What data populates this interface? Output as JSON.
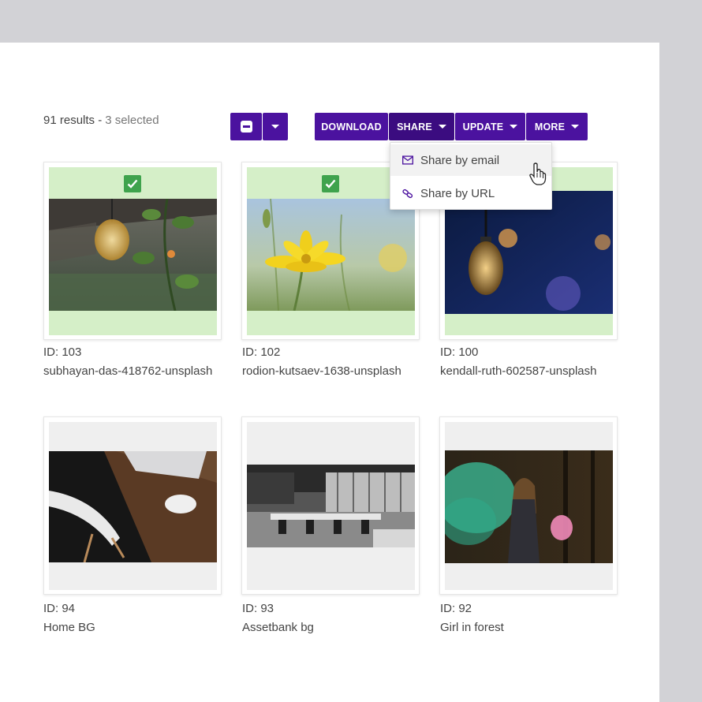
{
  "results": {
    "count_text": "91 results -",
    "selected_text": "3 selected"
  },
  "toolbar": {
    "select_icon": "minus-checkbox-icon",
    "download_label": "DOWNLOAD",
    "share_label": "SHARE",
    "update_label": "UPDATE",
    "more_label": "MORE",
    "accent": "#4b129f"
  },
  "share_menu": {
    "items": [
      {
        "label": "Share by email",
        "icon": "envelope-icon"
      },
      {
        "label": "Share by URL",
        "icon": "link-icon"
      }
    ]
  },
  "assets": [
    {
      "id_text": "ID: 103",
      "name": "subhayan-das-418762-unsplash",
      "selected": true
    },
    {
      "id_text": "ID: 102",
      "name": "rodion-kutsaev-1638-unsplash",
      "selected": true
    },
    {
      "id_text": "ID: 100",
      "name": "kendall-ruth-602587-unsplash",
      "selected": true
    },
    {
      "id_text": "ID: 94",
      "name": "Home BG",
      "selected": false
    },
    {
      "id_text": "ID: 93",
      "name": "Assetbank bg",
      "selected": false
    },
    {
      "id_text": "ID: 92",
      "name": "Girl in forest",
      "selected": false
    }
  ],
  "colors": {
    "selected_bg": "#d5efc8",
    "unselected_bg": "#efefef",
    "check_green": "#3fa34d"
  }
}
